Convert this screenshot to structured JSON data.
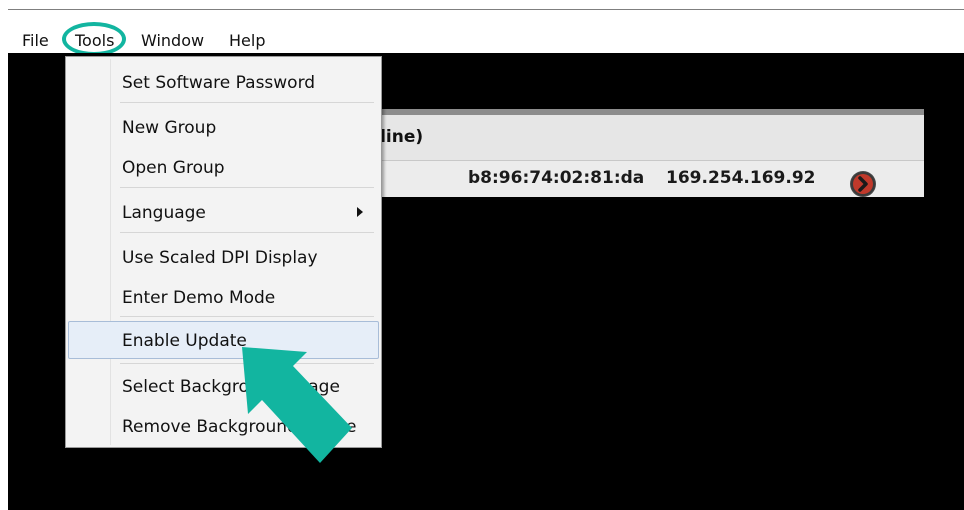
{
  "menubar": {
    "items": [
      "File",
      "Tools",
      "Window",
      "Help"
    ]
  },
  "tools_menu": {
    "items": [
      "Set Software Password",
      "New Group",
      "Open Group",
      "Language",
      "Use Scaled DPI Display",
      "Enter Demo Mode",
      "Enable Update",
      "Select Background Image",
      "Remove Background Image"
    ],
    "highlighted": "Enable Update"
  },
  "device_panel": {
    "header_visible_text": "nline)",
    "row": {
      "mac": "b8:96:74:02:81:da",
      "ip": "169.254.169.92"
    }
  },
  "annotation": {
    "accent_color": "#12b5a0",
    "go_icon": "chevron-right-icon",
    "go_icon_color": "#c0392b"
  }
}
